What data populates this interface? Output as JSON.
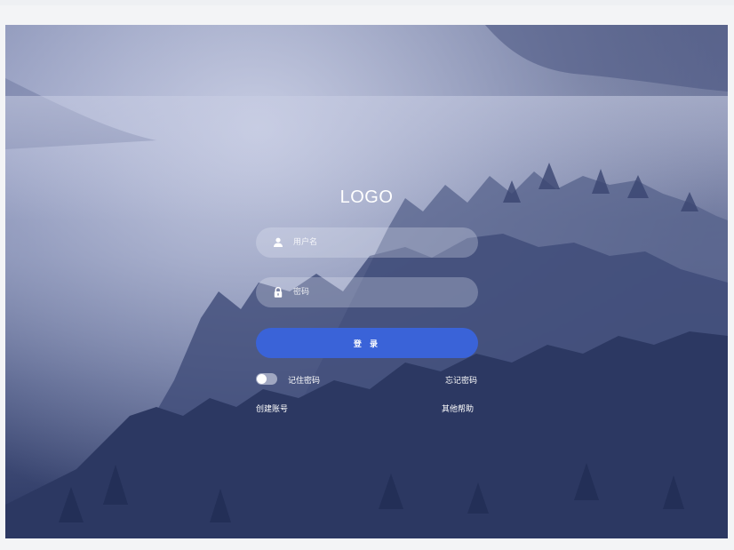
{
  "brand": {
    "logo_text": "LOGO"
  },
  "form": {
    "username_placeholder": "用户名",
    "password_placeholder": "密码",
    "login_label": "登 录",
    "remember_label": "记住密码",
    "remember_checked": false,
    "forgot_label": "忘记密码",
    "create_account_label": "创建账号",
    "help_label": "其他帮助"
  },
  "colors": {
    "accent": "#3a63d8",
    "text": "#ffffff",
    "background_dark": "#2b3762"
  },
  "icons": {
    "username": "user-icon",
    "password": "lock-icon"
  }
}
